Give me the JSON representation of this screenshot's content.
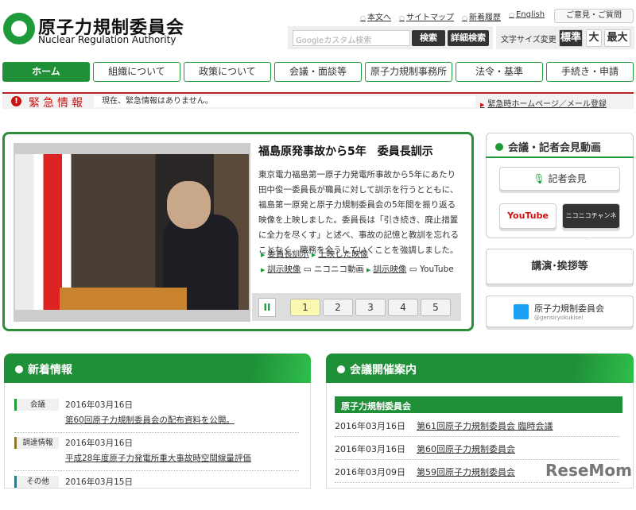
{
  "header": {
    "logo_ja": "原子力規制委員会",
    "logo_en": "Nuclear Regulation Authority",
    "links": [
      "本文へ",
      "サイトマップ",
      "新着履歴",
      "English"
    ],
    "opinion": "ご意見・ご質問",
    "search_placeholder": "Googleカスタム検索",
    "search_btn": "検索",
    "adv_search_btn": "詳細検索",
    "font_size_label": "文字サイズ変更",
    "font_sizes": [
      "標準",
      "大",
      "最大"
    ]
  },
  "nav": [
    "ホーム",
    "組織について",
    "政策について",
    "会議・面談等",
    "原子力規制事務所",
    "法令・基準",
    "手続き・申請"
  ],
  "emergency": {
    "title": "緊急情報",
    "text": "現在、緊急情報はありません。",
    "link": "緊急時ホームページ／メール登録"
  },
  "feature": {
    "title": "福島原発事故から5年　委員長訓示",
    "text": "東京電力福島第一原子力発電所事故から5年にあたり田中俊一委員長が職員に対して訓示を行うとともに、福島第一原発と原子力規制委員会の5年間を振り返る映像を上映しました。委員長は「引き続き、廃止措置に全力を尽くす」と述べ、事故の記憶と教訓を忘れることなく、職務を全うしていくことを強調しました。",
    "links": [
      "委員長訓示",
      "上映した映像",
      "訓示映像",
      "ニコニコ動画",
      "訓示映像",
      "YouTube"
    ],
    "pause": "II",
    "pages": [
      "1",
      "2",
      "3",
      "4",
      "5"
    ],
    "current_page": 1
  },
  "sidebar": {
    "video_title": "会議・記者会見動画",
    "press": "記者会見",
    "youtube": "YouTube",
    "nico": "ニコニコチャンネル",
    "speech": "講演･挨拶等",
    "twitter_name": "原子力規制委員会",
    "twitter_handle": "@gensiryokukisei"
  },
  "news": {
    "title": "新着情報",
    "items": [
      {
        "cat": "会議",
        "date": "2016年03月16日",
        "title": "第60回原子力規制委員会の配布資料を公開。"
      },
      {
        "cat": "調達情報",
        "date": "2016年03月16日",
        "title": "平成28年度原子力発電所重大事故時空間線量評価"
      },
      {
        "cat": "その他",
        "date": "2016年03月15日",
        "title": ""
      }
    ]
  },
  "meetings": {
    "title": "会議開催案内",
    "group": "原子力規制委員会",
    "items": [
      {
        "date": "2016年03月16日",
        "title": "第61回原子力規制委員会 臨時会議"
      },
      {
        "date": "2016年03月16日",
        "title": "第60回原子力規制委員会"
      },
      {
        "date": "2016年03月09日",
        "title": "第59回原子力規制委員会"
      }
    ]
  },
  "watermark": "ReseMom"
}
